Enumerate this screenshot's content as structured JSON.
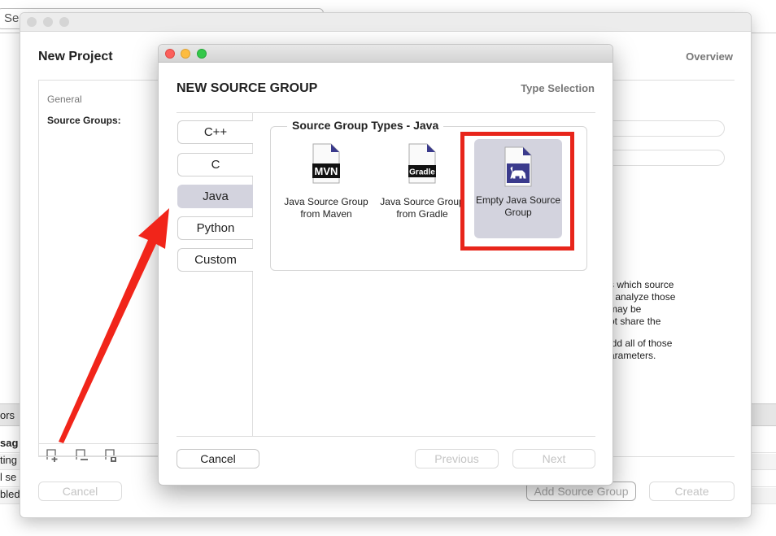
{
  "background": {
    "search_fragment": "Se",
    "bar_fragment": "ors",
    "rows": [
      "sag",
      "ting",
      "l se",
      "bled"
    ]
  },
  "project_window": {
    "title": "New Project",
    "step": "Overview",
    "sidebar": {
      "general_label": "General",
      "source_groups_label": "Source Groups:"
    },
    "description_lines": [
      "s which source",
      ") analyze those",
      "may be",
      "ot share the",
      "idd all of those",
      "arameters."
    ],
    "buttons": {
      "cancel": "Cancel",
      "add_source_group": "Add Source Group",
      "create": "Create"
    }
  },
  "dialog": {
    "title": "NEW SOURCE GROUP",
    "step": "Type Selection",
    "languages": [
      {
        "label": "C++"
      },
      {
        "label": "C"
      },
      {
        "label": "Java",
        "selected": true
      },
      {
        "label": "Python"
      },
      {
        "label": "Custom"
      }
    ],
    "group_title": "Source Group Types - Java",
    "types": [
      {
        "label": "Java Source Group from Maven",
        "badge": "MVN"
      },
      {
        "label": "Java Source Group from Gradle",
        "badge": "Gradle"
      },
      {
        "label": "Empty Java Source Group",
        "selected": true
      }
    ],
    "buttons": {
      "cancel": "Cancel",
      "previous": "Previous",
      "next": "Next"
    }
  },
  "colors": {
    "highlight": "#e8251b",
    "selection": "#d3d3de",
    "icon_blue": "#3a3a8c"
  }
}
